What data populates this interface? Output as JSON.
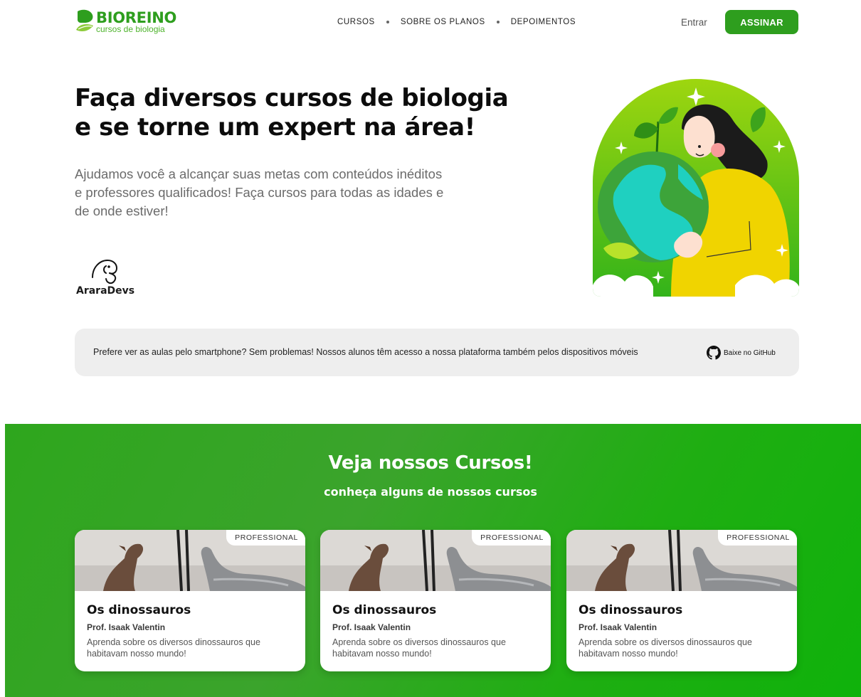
{
  "brand": {
    "name": "BIOREINO",
    "tagline": "cursos de biologia",
    "primary_color": "#2e9e1e",
    "accent_green": "#4db32b"
  },
  "nav": {
    "items": [
      "CURSOS",
      "SOBRE OS PLANOS",
      "DEPOIMENTOS"
    ],
    "login_label": "Entrar",
    "subscribe_label": "ASSINAR"
  },
  "hero": {
    "title_line1": "Faça diversos cursos de biologia",
    "title_line2": "e se torne um expert na área!",
    "text": "Ajudamos você a alcançar suas metas com conteúdos inéditos e professores qualificados! Faça cursos para todas as idades e de onde estiver!",
    "partner_name": "AraraDevs",
    "illustration": "woman-hugging-earth-illustration"
  },
  "banner": {
    "text": "Prefere ver as aulas pelo smartphone? Sem problemas! Nossos alunos têm acesso a nossa plataforma também pelos dispositivos móveis",
    "github_label": "Baixe no GitHub",
    "github_icon": "github-icon"
  },
  "courses": {
    "title": "Veja nossos Cursos!",
    "subtitle": "conheça alguns de nossos cursos",
    "section_color": "#2ea61d",
    "cards": [
      {
        "badge": "PROFESSIONAL",
        "title": "Os dinossauros",
        "professor": "Prof. Isaak Valentin",
        "description": "Aprenda sobre os diversos dinossauros que habitavam nosso mundo!",
        "image": "dinosaur-toys-photo"
      },
      {
        "badge": "PROFESSIONAL",
        "title": "Os dinossauros",
        "professor": "Prof. Isaak Valentin",
        "description": "Aprenda sobre os diversos dinossauros que habitavam nosso mundo!",
        "image": "dinosaur-toys-photo"
      },
      {
        "badge": "PROFESSIONAL",
        "title": "Os dinossauros",
        "professor": "Prof. Isaak Valentin",
        "description": "Aprenda sobre os diversos dinossauros que habitavam nosso mundo!",
        "image": "dinosaur-toys-photo"
      }
    ]
  }
}
